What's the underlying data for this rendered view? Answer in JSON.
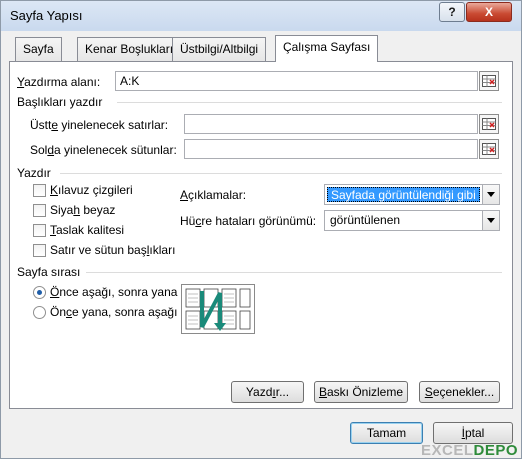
{
  "window": {
    "title": "Sayfa Yapısı",
    "help_label": "?",
    "close_label": "X"
  },
  "tabs": [
    {
      "label": "Sayfa",
      "active": false
    },
    {
      "label": "Kenar Boşlukları",
      "active": false
    },
    {
      "label": "Üstbilgi/Altbilgi",
      "active": false
    },
    {
      "label": "Çalışma Sayfası",
      "active": true
    }
  ],
  "print_area": {
    "label_pre": "",
    "label_u": "Y",
    "label_post": "azdırma alanı:",
    "value": "A:K"
  },
  "print_titles": {
    "heading": "Başlıkları yazdır",
    "rows_label_pre": "Üstt",
    "rows_label_u": "e",
    "rows_label_post": " yinelenecek satırlar:",
    "rows_value": "",
    "cols_label_pre": "Sol",
    "cols_label_u": "d",
    "cols_label_post": "a yinelenecek sütunlar:",
    "cols_value": ""
  },
  "print_section": {
    "heading": "Yazdır",
    "gridlines_u": "K",
    "gridlines_rest": "ılavuz çizgileri",
    "bw_pre": "Siya",
    "bw_u": "h",
    "bw_post": " beyaz",
    "draft_u": "T",
    "draft_rest": "aslak kalitesi",
    "headings_pre": "Satır ve sütun baş",
    "headings_u": "l",
    "headings_post": "ıkları",
    "comments_label_pre": "",
    "comments_label_u": "A",
    "comments_label_post": "çıklamalar:",
    "comments_value": "Sayfada görüntülendiği gibi",
    "errors_label_pre": "Hü",
    "errors_label_u": "c",
    "errors_label_post": "re hataları görünümü:",
    "errors_value": "görüntülenen"
  },
  "page_order": {
    "heading": "Sayfa sırası",
    "down_then_over_pre": "",
    "down_then_over_u": "Ö",
    "down_then_over_post": "nce aşağı, sonra yana",
    "over_then_down_pre": "Ön",
    "over_then_down_u": "c",
    "over_then_down_post": "e yana, sonra aşağı",
    "selected": "down_then_over"
  },
  "buttons": {
    "print_pre": "Yazd",
    "print_u": "ı",
    "print_post": "r...",
    "preview_u": "B",
    "preview_rest": "askı Önizleme",
    "options_pre": "",
    "options_u": "S",
    "options_post": "eçenekler...",
    "ok": "Tamam",
    "cancel_u": "İ",
    "cancel_rest": "ptal"
  },
  "watermark": {
    "text_a": "EXCEL",
    "text_b": "DEPO"
  },
  "colors": {
    "accent": "#3399ff",
    "order_arrow": "#1a8a7a"
  }
}
